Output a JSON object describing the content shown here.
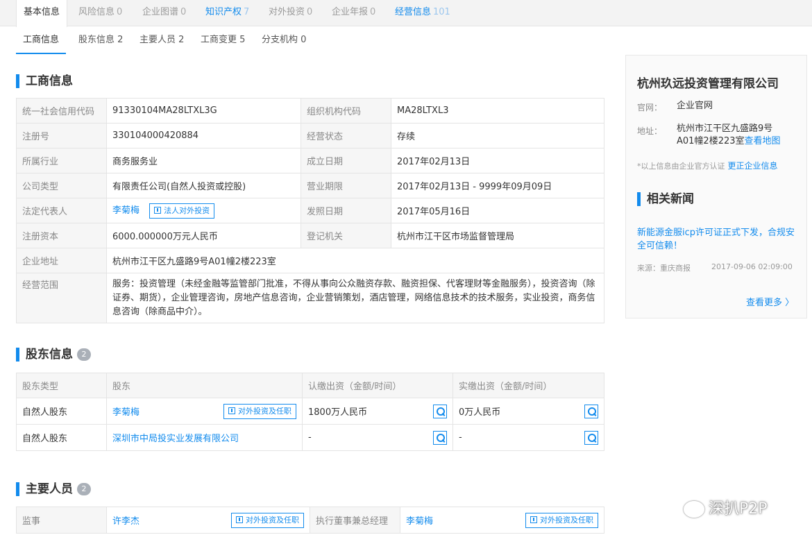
{
  "top_tabs": [
    {
      "label": "基本信息",
      "count": ""
    },
    {
      "label": "风险信息",
      "count": "0"
    },
    {
      "label": "企业图谱",
      "count": "0"
    },
    {
      "label": "知识产权",
      "count": "7"
    },
    {
      "label": "对外投资",
      "count": "0"
    },
    {
      "label": "企业年报",
      "count": "0"
    },
    {
      "label": "经营信息",
      "count": "101"
    }
  ],
  "sub_tabs": [
    {
      "label": "工商信息"
    },
    {
      "label": "股东信息 2"
    },
    {
      "label": "主要人员 2"
    },
    {
      "label": "工商变更 5"
    },
    {
      "label": "分支机构 0"
    }
  ],
  "business_info": {
    "title": "工商信息",
    "rows": [
      {
        "l1": "统一社会信用代码",
        "v1": "91330104MA28LTXL3G",
        "l2": "组织机构代码",
        "v2": "MA28LTXL3"
      },
      {
        "l1": "注册号",
        "v1": "330104000420884",
        "l2": "经营状态",
        "v2": "存续"
      },
      {
        "l1": "所属行业",
        "v1": "商务服务业",
        "l2": "成立日期",
        "v2": "2017年02月13日"
      },
      {
        "l1": "公司类型",
        "v1": "有限责任公司(自然人投资或控股)",
        "l2": "营业期限",
        "v2": "2017年02月13日 - 9999年09月09日"
      },
      {
        "l1": "法定代表人",
        "v1": "李菊梅",
        "v1_btn": "法人对外投资",
        "l2": "发照日期",
        "v2": "2017年05月16日"
      },
      {
        "l1": "注册资本",
        "v1": "6000.000000万元人民币",
        "l2": "登记机关",
        "v2": "杭州市江干区市场监督管理局"
      }
    ],
    "address_label": "企业地址",
    "address": "杭州市江干区九盛路9号A01幢2楼223室",
    "scope_label": "经营范围",
    "scope": "服务：投资管理（未经金融等监管部门批准，不得从事向公众融资存款、融资担保、代客理财等金融服务），投资咨询（除证券、期货），企业管理咨询，房地产信息咨询，企业营销策划，酒店管理，网络信息技术的技术服务，实业投资，商务信息咨询（除商品中介）。"
  },
  "shareholders": {
    "title": "股东信息",
    "count": "2",
    "headers": [
      "股东类型",
      "股东",
      "认缴出资（金额/时间）",
      "实缴出资（金额/时间）"
    ],
    "rows": [
      {
        "type": "自然人股东",
        "name": "李菊梅",
        "btn": "对外投资及任职",
        "subscribed": "1800万人民币",
        "paid": "0万人民币"
      },
      {
        "type": "自然人股东",
        "name": "深圳市中局投实业发展有限公司",
        "btn": "",
        "subscribed": "-",
        "paid": "-"
      }
    ]
  },
  "key_people": {
    "title": "主要人员",
    "count": "2",
    "rows": [
      {
        "role1": "监事",
        "name1": "许李杰",
        "btn1": "对外投资及任职",
        "role2": "执行董事兼总经理",
        "name2": "李菊梅",
        "btn2": "对外投资及任职"
      }
    ]
  },
  "side_panel": {
    "company": "杭州玖远投资管理有限公司",
    "website_label": "官网：",
    "website": "企业官网",
    "address_label": "地址：",
    "address_line1": "杭州市江干区九盛路9号",
    "address_line2": "A01幢2楼223室",
    "map_link": "查看地图",
    "note": "*以上信息由企业官方认证",
    "update_link": "更正企业信息",
    "news_title": "相关新闻",
    "news_headline": "新能源金服icp许可证正式下发，合规安全可信赖！",
    "news_source": "来源：重庆商报",
    "news_date": "2017-09-06 02:09:00",
    "more": "查看更多 〉"
  },
  "watermark": "深扒P2P",
  "colors": {
    "accent": "#128bed",
    "label_bg": "#f6f6f6",
    "border": "#e4e4e4"
  }
}
